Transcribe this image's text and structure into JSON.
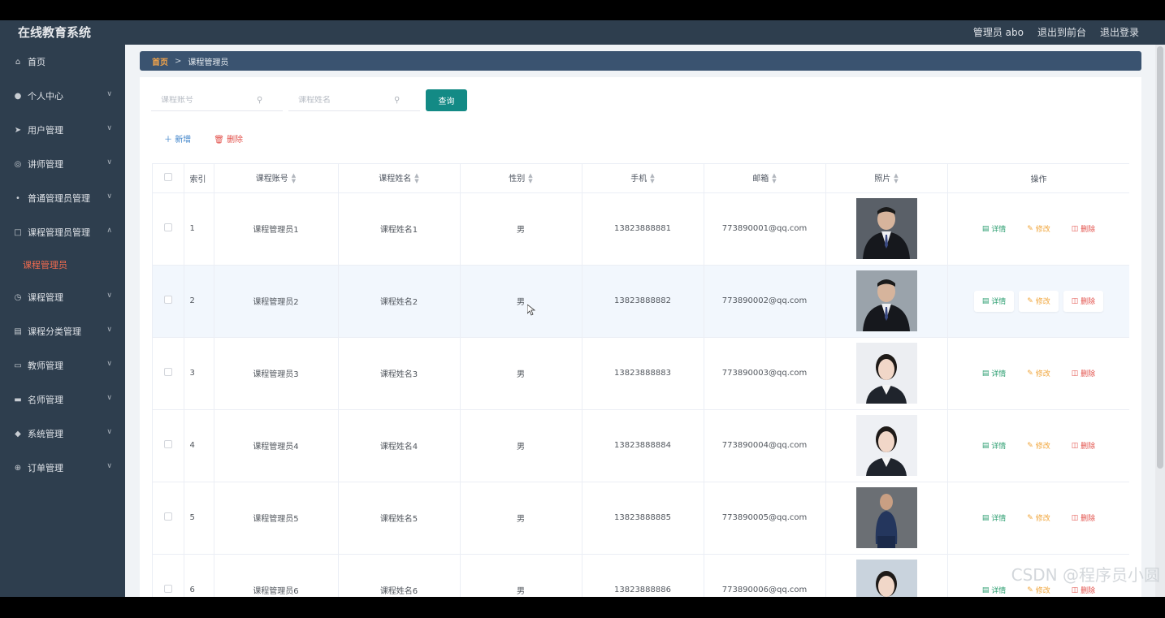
{
  "app": {
    "title": "在线教育系统",
    "user_label": "管理员 abo",
    "front_link": "退出到前台",
    "logout_link": "退出登录"
  },
  "sidebar": {
    "items": [
      {
        "label": "首页",
        "icon": "home-icon",
        "chevron": false
      },
      {
        "label": "个人中心",
        "icon": "user-icon",
        "chevron": true
      },
      {
        "label": "用户管理",
        "icon": "send-icon",
        "chevron": true
      },
      {
        "label": "讲师管理",
        "icon": "compass-icon",
        "chevron": true
      },
      {
        "label": "普通管理员管理",
        "icon": "microphone-icon",
        "chevron": true
      },
      {
        "label": "课程管理员管理",
        "icon": "crop-icon",
        "chevron": true,
        "expanded": true
      },
      {
        "label": "课程管理",
        "icon": "clock-icon",
        "chevron": true
      },
      {
        "label": "课程分类管理",
        "icon": "clipboard-icon",
        "chevron": true
      },
      {
        "label": "教师管理",
        "icon": "monitor-icon",
        "chevron": true
      },
      {
        "label": "名师管理",
        "icon": "chat-icon",
        "chevron": true
      },
      {
        "label": "系统管理",
        "icon": "location-icon",
        "chevron": true
      },
      {
        "label": "订单管理",
        "icon": "globe-icon",
        "chevron": true
      }
    ],
    "active_sub": "课程管理员"
  },
  "breadcrumb": {
    "home": "首页",
    "separator": ">",
    "current": "课程管理员"
  },
  "search": {
    "account_placeholder": "课程账号",
    "name_placeholder": "课程姓名",
    "query_label": "查询"
  },
  "actions": {
    "add_label": "新增",
    "delete_label": "删除"
  },
  "table": {
    "headers": {
      "index": "索引",
      "account": "课程账号",
      "name": "课程姓名",
      "gender": "性别",
      "phone": "手机",
      "email": "邮箱",
      "photo": "照片",
      "ops": "操作"
    },
    "op_labels": {
      "detail": "详情",
      "edit": "修改",
      "delete": "删除"
    },
    "rows": [
      {
        "index": "1",
        "account": "课程管理员1",
        "name": "课程姓名1",
        "gender": "男",
        "phone": "13823888881",
        "email": "773890001@qq.com",
        "photo_bg": "#5a6068",
        "photo_type": "man"
      },
      {
        "index": "2",
        "account": "课程管理员2",
        "name": "课程姓名2",
        "gender": "男",
        "phone": "13823888882",
        "email": "773890002@qq.com",
        "photo_bg": "#9aa3ab",
        "photo_type": "man"
      },
      {
        "index": "3",
        "account": "课程管理员3",
        "name": "课程姓名3",
        "gender": "男",
        "phone": "13823888883",
        "email": "773890003@qq.com",
        "photo_bg": "#eceef2",
        "photo_type": "woman"
      },
      {
        "index": "4",
        "account": "课程管理员4",
        "name": "课程姓名4",
        "gender": "男",
        "phone": "13823888884",
        "email": "773890004@qq.com",
        "photo_bg": "#eef0f4",
        "photo_type": "woman"
      },
      {
        "index": "5",
        "account": "课程管理员5",
        "name": "课程姓名5",
        "gender": "男",
        "phone": "13823888885",
        "email": "773890005@qq.com",
        "photo_bg": "#6b6f74",
        "photo_type": "man-seated"
      },
      {
        "index": "6",
        "account": "课程管理员6",
        "name": "课程姓名6",
        "gender": "男",
        "phone": "13823888886",
        "email": "773890006@qq.com",
        "photo_bg": "#c9d3dd",
        "photo_type": "woman"
      }
    ]
  },
  "watermark": "CSDN @程序员小圆"
}
